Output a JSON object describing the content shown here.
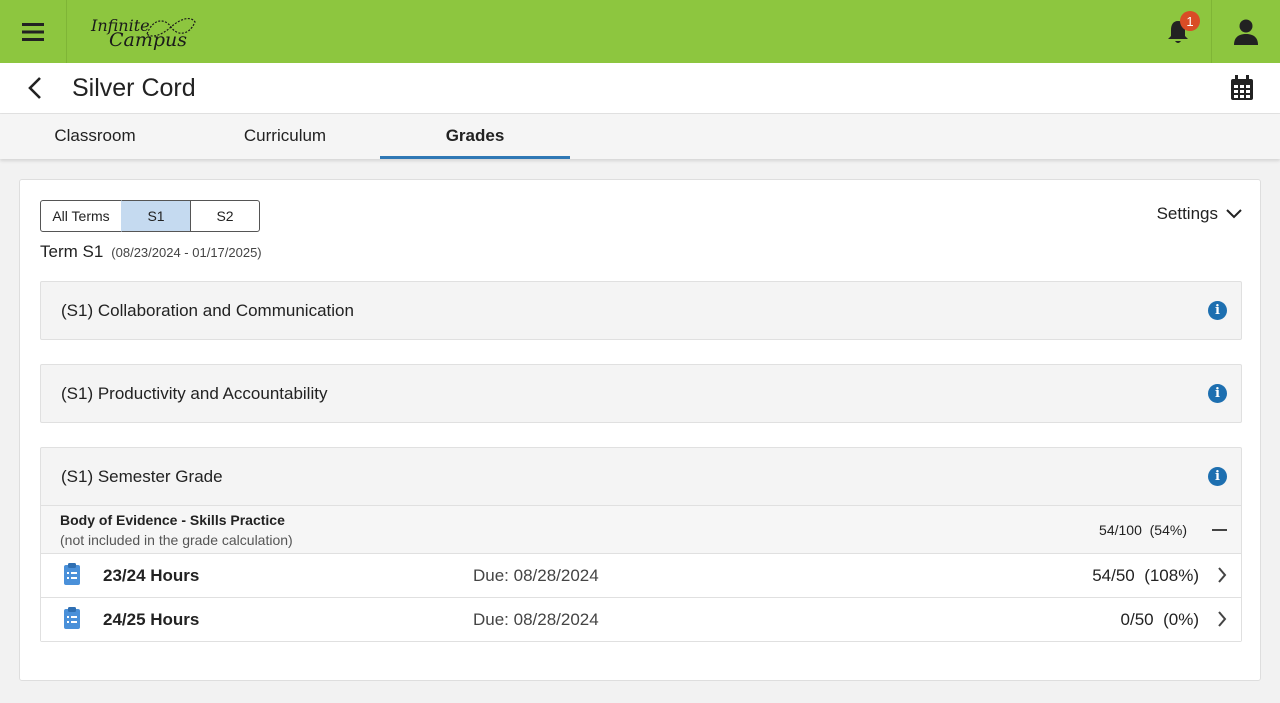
{
  "header": {
    "logo_line1": "Infinite",
    "logo_line2": "Campus",
    "notification_count": "1"
  },
  "titlebar": {
    "title": "Silver Cord"
  },
  "tabs": [
    {
      "label": "Classroom",
      "active": false
    },
    {
      "label": "Curriculum",
      "active": false
    },
    {
      "label": "Grades",
      "active": true
    }
  ],
  "terms": {
    "buttons": [
      "All Terms",
      "S1",
      "S2"
    ],
    "selected": "S1",
    "label": "Term S1",
    "dates": "(08/23/2024 - 01/17/2025)"
  },
  "settings": {
    "label": "Settings"
  },
  "sections": [
    {
      "title": "(S1) Collaboration and Communication"
    },
    {
      "title": "(S1) Productivity and Accountability"
    },
    {
      "title": "(S1) Semester Grade",
      "group": {
        "title": "Body of Evidence - Skills Practice",
        "note": "(not included in the grade calculation)",
        "score": "54/100",
        "percent": "(54%)"
      },
      "items": [
        {
          "name": "23/24 Hours",
          "due": "Due: 08/28/2024",
          "score": "54/50",
          "percent": "(108%)"
        },
        {
          "name": "24/25 Hours",
          "due": "Due: 08/28/2024",
          "score": "0/50",
          "percent": "(0%)"
        }
      ]
    }
  ],
  "colors": {
    "brand_green": "#8dc63f",
    "tab_active": "#2f78b5",
    "info_blue": "#1d6fb0",
    "badge_red": "#d94c26",
    "selected_term": "#c5daf0"
  }
}
